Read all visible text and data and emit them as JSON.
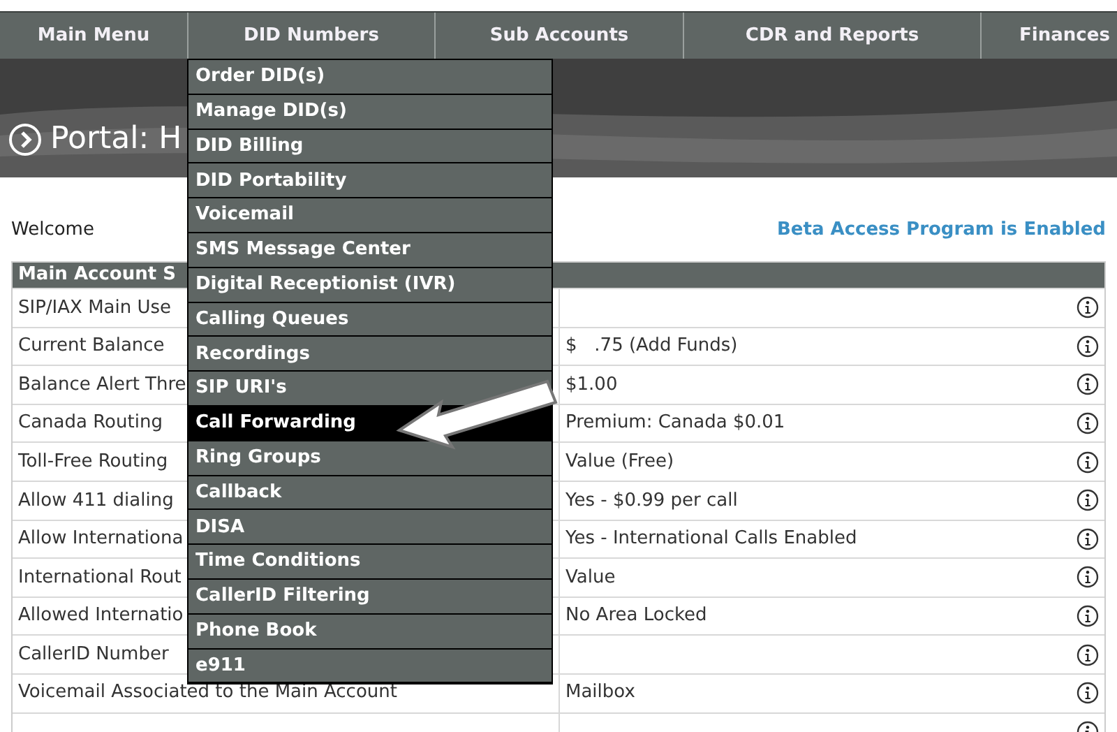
{
  "nav": [
    {
      "label": "Main Menu"
    },
    {
      "label": "DID Numbers"
    },
    {
      "label": "Sub Accounts"
    },
    {
      "label": "CDR and Reports"
    },
    {
      "label": "Finances"
    }
  ],
  "banner": {
    "title": "Portal: H"
  },
  "welcome": "Welcome",
  "beta_notice": "Beta Access Program is Enabled",
  "table": {
    "header": "Main Account S",
    "rows": [
      {
        "label": "SIP/IAX Main Use"
      },
      {
        "label": "Current Balance",
        "value": "$   .75 (Add Funds)"
      },
      {
        "label": "Balance Alert Thre",
        "value": "$1.00"
      },
      {
        "label": "Canada Routing",
        "value": "Premium: Canada $0.01"
      },
      {
        "label": "Toll-Free Routing",
        "value": "Value (Free)"
      },
      {
        "label": "Allow 411 dialing",
        "value": "Yes - $0.99 per call"
      },
      {
        "label": "Allow Internationa",
        "value": "Yes - International Calls Enabled"
      },
      {
        "label": "International Rout",
        "value": "Value"
      },
      {
        "label": "Allowed Internatio",
        "value": "No Area Locked"
      },
      {
        "label": "CallerID Number"
      },
      {
        "label": "Voicemail Associated to the Main Account",
        "value": "Mailbox"
      },
      {}
    ]
  },
  "menu": {
    "items": [
      {
        "label": "Order DID(s)",
        "selected": false
      },
      {
        "label": "Manage DID(s)",
        "selected": false
      },
      {
        "label": "DID Billing",
        "selected": false
      },
      {
        "label": "DID Portability",
        "selected": false
      },
      {
        "label": "Voicemail",
        "selected": false
      },
      {
        "label": "SMS Message Center",
        "selected": false
      },
      {
        "label": "Digital Receptionist (IVR)",
        "selected": false
      },
      {
        "label": "Calling Queues",
        "selected": false
      },
      {
        "label": "Recordings",
        "selected": false
      },
      {
        "label": "SIP URI's",
        "selected": false
      },
      {
        "label": "Call Forwarding",
        "selected": true
      },
      {
        "label": "Ring Groups",
        "selected": false
      },
      {
        "label": "Callback",
        "selected": false
      },
      {
        "label": "DISA",
        "selected": false
      },
      {
        "label": "Time Conditions",
        "selected": false
      },
      {
        "label": "CallerID Filtering",
        "selected": false
      },
      {
        "label": "Phone Book",
        "selected": false
      },
      {
        "label": "e911",
        "selected": false
      }
    ]
  }
}
